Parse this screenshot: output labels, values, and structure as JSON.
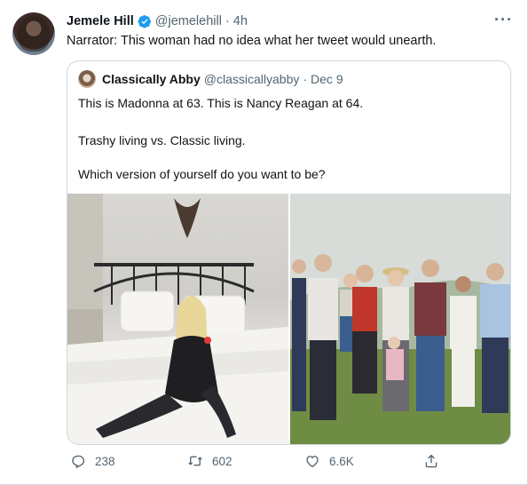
{
  "author": {
    "name": "Jemele Hill",
    "handle": "@jemelehill",
    "separator": "·",
    "time": "4h",
    "verified": true
  },
  "tweet_text": "Narrator: This woman had no idea what her tweet would unearth.",
  "more_label": "···",
  "quoted": {
    "name": "Classically Abby",
    "handle": "@classicallyabby",
    "separator": "·",
    "time": "Dec 9",
    "lines": [
      "This is Madonna at 63. This is Nancy Reagan at 64.",
      "Trashy living vs. Classic living.",
      "Which version of yourself do you want to be?"
    ]
  },
  "actions": {
    "reply_count": "238",
    "retweet_count": "602",
    "like_count": "6.6K"
  },
  "colors": {
    "accent": "#1d9bf0",
    "muted": "#536471",
    "border": "#cfd9de"
  }
}
